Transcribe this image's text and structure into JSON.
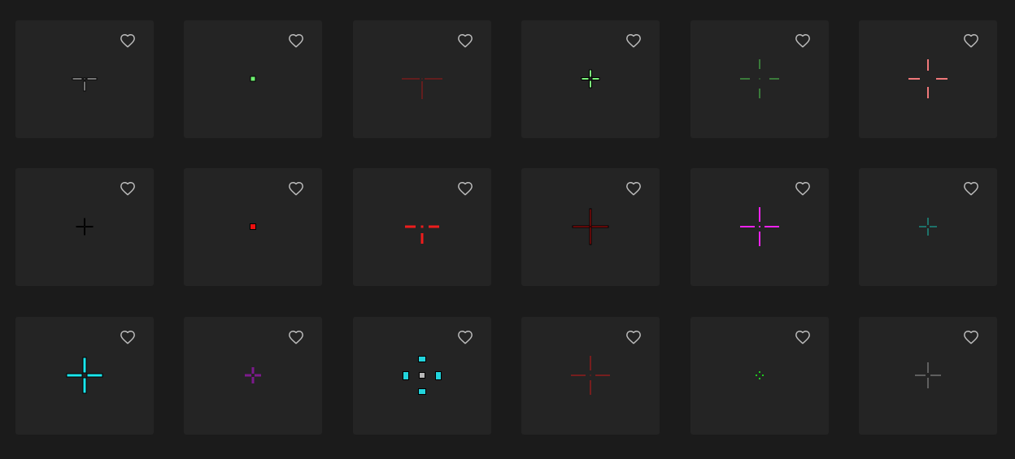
{
  "crosshairs": [
    {
      "type": "t",
      "color": "#e8e8e8",
      "gap": 3,
      "len": 12,
      "thick": 2,
      "dot": true,
      "outline": true
    },
    {
      "type": "dot",
      "color": "#6ef070",
      "size": 6,
      "outline": true
    },
    {
      "type": "t",
      "color": "#a01818",
      "gap": 3,
      "len": 22,
      "thick": 1,
      "dot": true,
      "outline": false
    },
    {
      "type": "cross",
      "color": "#7cf57c",
      "gap": 2,
      "len": 9,
      "thick": 3,
      "dot": false,
      "outline": true
    },
    {
      "type": "cross",
      "color": "#4fcf4f",
      "gap": 12,
      "len": 12,
      "thick": 1,
      "dot": true,
      "outline": false
    },
    {
      "type": "cross",
      "color": "#f0787a",
      "gap": 10,
      "len": 14,
      "thick": 2,
      "dot": false,
      "outline": false
    },
    {
      "type": "cross",
      "color": "#e6e63a",
      "gap": 1,
      "len": 9,
      "thick": 1,
      "dot": false,
      "outline": true
    },
    {
      "type": "dot",
      "color": "#ee1010",
      "size": 7,
      "outline": true
    },
    {
      "type": "t",
      "color": "#ee1c1c",
      "gap": 8,
      "len": 13,
      "thick": 3,
      "dot": true,
      "outline": false
    },
    {
      "type": "cross",
      "color": "#c41010",
      "gap": 0,
      "len": 22,
      "thick": 2,
      "dot": false,
      "outline": true
    },
    {
      "type": "cross",
      "color": "#ee22ee",
      "gap": 6,
      "len": 18,
      "thick": 2,
      "dot": true,
      "outline": false
    },
    {
      "type": "cross",
      "color": "#18c0b0",
      "gap": 2,
      "len": 9,
      "thick": 1,
      "dot": false,
      "outline": false
    },
    {
      "type": "cross",
      "color": "#1ae8ee",
      "gap": 3,
      "len": 19,
      "thick": 4,
      "dot": false,
      "outline": true
    },
    {
      "type": "cross",
      "color": "#7c1a8c",
      "gap": 2,
      "len": 8,
      "thick": 3,
      "dot": false,
      "outline": false
    },
    {
      "type": "boxes",
      "color": "#22d4dc",
      "center": "#b8b8b8",
      "gap": 16,
      "w": 9,
      "h": 7
    },
    {
      "type": "cross",
      "color": "#c81818",
      "gap": 6,
      "len": 18,
      "thick": 1,
      "dot": true,
      "outline": false
    },
    {
      "type": "dotsquare",
      "color": "#1ecc1e",
      "gap": 3,
      "size": 2
    },
    {
      "type": "cross",
      "color": "#9a9a9a",
      "gap": 3,
      "len": 13,
      "thick": 1,
      "dot": false,
      "outline": false
    }
  ]
}
